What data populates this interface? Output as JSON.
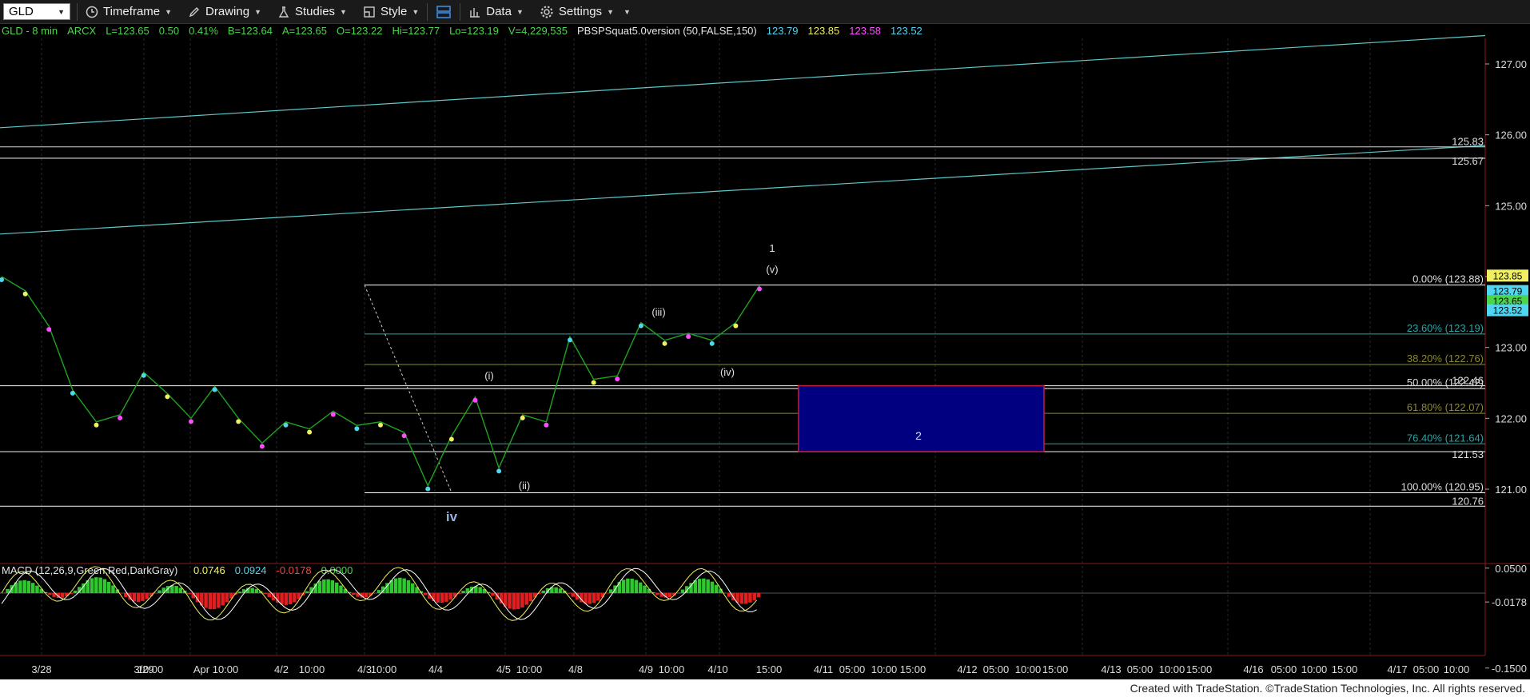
{
  "toolbar": {
    "symbol": "GLD",
    "items": [
      {
        "label": "Timeframe",
        "icon": "clock-icon"
      },
      {
        "label": "Drawing",
        "icon": "pencil-icon"
      },
      {
        "label": "Studies",
        "icon": "flask-icon"
      },
      {
        "label": "Style",
        "icon": "style-icon"
      },
      {
        "label": "",
        "icon": "layout-icon"
      },
      {
        "label": "Data",
        "icon": "bars-icon"
      },
      {
        "label": "Settings",
        "icon": "gear-icon"
      }
    ]
  },
  "header": {
    "items": [
      {
        "text": "GLD - 8 min",
        "color": "#4cd54c"
      },
      {
        "text": "ARCX",
        "color": "#4cd54c"
      },
      {
        "text": "L=123.65",
        "color": "#4cd54c"
      },
      {
        "text": "0.50",
        "color": "#4cd54c"
      },
      {
        "text": "0.41%",
        "color": "#4cd54c"
      },
      {
        "text": "B=123.64",
        "color": "#4cd54c"
      },
      {
        "text": "A=123.65",
        "color": "#4cd54c"
      },
      {
        "text": "O=123.22",
        "color": "#4cd54c"
      },
      {
        "text": "Hi=123.77",
        "color": "#4cd54c"
      },
      {
        "text": "Lo=123.19",
        "color": "#4cd54c"
      },
      {
        "text": "V=4,229,535",
        "color": "#4cd54c"
      },
      {
        "text": "PBSPSquat5.0version (50,FALSE,150)",
        "color": "#e6e6e6"
      },
      {
        "text": "123.79",
        "color": "#4fd6f0"
      },
      {
        "text": "123.85",
        "color": "#f0f060"
      },
      {
        "text": "123.58",
        "color": "#ff4cff"
      },
      {
        "text": "123.52",
        "color": "#4fd6f0"
      }
    ]
  },
  "chart_data": [
    {
      "type": "candlestick",
      "title": "GLD - 8 min",
      "ylim": [
        120.2,
        127.35
      ],
      "y_ticks": [
        "127.00",
        "126.00",
        "125.00",
        "124.00",
        "123.00",
        "122.00",
        "121.00"
      ],
      "x_tick_labels": [
        "3/28",
        "3/29",
        "10:00",
        "Apr",
        "10:00",
        "4/2",
        "10:00",
        "4/3",
        "10:00",
        "4/4",
        "4/5",
        "10:00",
        "4/8",
        "4/9",
        "10:00",
        "4/10",
        "15:00",
        "4/11",
        "05:00",
        "10:00",
        "15:00",
        "4/12",
        "05:00",
        "10:00",
        "15:00",
        "4/13",
        "05:00",
        "10:00",
        "15:00",
        "4/16",
        "05:00",
        "10:00",
        "15:00",
        "4/17",
        "05:00",
        "10:00"
      ],
      "price_series": [
        {
          "date": "3/28",
          "value": 124.0
        },
        {
          "date": "3/28",
          "value": 123.8
        },
        {
          "date": "3/28",
          "value": 123.3
        },
        {
          "date": "3/28",
          "value": 122.4
        },
        {
          "date": "3/28",
          "value": 121.95
        },
        {
          "date": "3/29",
          "value": 122.05
        },
        {
          "date": "3/29",
          "value": 122.65
        },
        {
          "date": "3/29",
          "value": 122.35
        },
        {
          "date": "3/29",
          "value": 122.0
        },
        {
          "date": "Apr",
          "value": 122.45
        },
        {
          "date": "Apr",
          "value": 122.0
        },
        {
          "date": "Apr",
          "value": 121.65
        },
        {
          "date": "4/2",
          "value": 121.95
        },
        {
          "date": "4/2",
          "value": 121.85
        },
        {
          "date": "4/2",
          "value": 122.1
        },
        {
          "date": "4/3",
          "value": 121.9
        },
        {
          "date": "4/3",
          "value": 121.95
        },
        {
          "date": "4/3",
          "value": 121.8
        },
        {
          "date": "4/4",
          "value": 121.05
        },
        {
          "date": "4/4",
          "value": 121.75
        },
        {
          "date": "4/4",
          "value": 122.3
        },
        {
          "date": "4/5",
          "value": 121.3
        },
        {
          "date": "4/5",
          "value": 122.05
        },
        {
          "date": "4/5",
          "value": 121.95
        },
        {
          "date": "4/8",
          "value": 123.15
        },
        {
          "date": "4/8",
          "value": 122.55
        },
        {
          "date": "4/8",
          "value": 122.6
        },
        {
          "date": "4/9",
          "value": 123.35
        },
        {
          "date": "4/9",
          "value": 123.1
        },
        {
          "date": "4/9",
          "value": 123.2
        },
        {
          "date": "4/10",
          "value": 123.1
        },
        {
          "date": "4/10",
          "value": 123.35
        },
        {
          "date": "4/10",
          "value": 123.87
        }
      ],
      "trend_lines": [
        {
          "from": {
            "date": "3/28",
            "value": 126.1
          },
          "to": {
            "date": "4/17",
            "value": 127.4
          }
        },
        {
          "from": {
            "date": "3/28",
            "value": 124.6
          },
          "to": {
            "date": "4/17",
            "value": 125.85
          }
        }
      ],
      "horizontal_lines": [
        125.83,
        125.67,
        122.46,
        121.53,
        120.76
      ],
      "price_labels": [
        "125.83",
        "125.67",
        "122.46",
        "121.53",
        "120.76"
      ],
      "fibonacci": {
        "levels": [
          {
            "label": "0.00% (123.88)",
            "value": 123.88
          },
          {
            "label": "23.60% (123.19)",
            "value": 123.19
          },
          {
            "label": "38.20% (122.76)",
            "value": 122.76
          },
          {
            "label": "50.00% (122.42)",
            "value": 122.42
          },
          {
            "label": "61.80% (122.07)",
            "value": 122.07
          },
          {
            "label": "76.40% (121.64)",
            "value": 121.64
          },
          {
            "label": "100.00% (120.95)",
            "value": 120.95
          }
        ],
        "colors": [
          "#ffffff",
          "#2aa6a6",
          "#8a8a2a",
          "#ffffff",
          "#8a8a2a",
          "#2aa6a6",
          "#ffffff"
        ]
      },
      "target_box": {
        "label": "2",
        "top": 122.46,
        "bottom": 121.53,
        "from": "4/10",
        "to": "4/12",
        "fill": "#000080",
        "border": "#c0203c"
      },
      "wave_labels": [
        {
          "text": "1",
          "value": 124.35
        },
        {
          "text": "(v)",
          "value": 124.05
        },
        {
          "text": "(iii)",
          "value": 123.45
        },
        {
          "text": "(iv)",
          "value": 122.6
        },
        {
          "text": "(i)",
          "value": 122.55
        },
        {
          "text": "(ii)",
          "value": 121.0
        },
        {
          "text": "iv",
          "value": 120.55
        }
      ],
      "last_price_tags": [
        {
          "text": "123.79",
          "color": "#4fd6f0"
        },
        {
          "text": "123.85",
          "color": "#f0f060"
        },
        {
          "text": "123.65",
          "color": "#4cd54c"
        },
        {
          "text": "123.52",
          "color": "#4fd6f0"
        }
      ]
    },
    {
      "type": "macd",
      "title": "MACD (12,26,9,Green,Red,DarkGray)",
      "legend": [
        {
          "text": "0.0746",
          "color": "#f0f060"
        },
        {
          "text": "0.0924",
          "color": "#4fd6f0"
        },
        {
          "text": "-0.0178",
          "color": "#ff4040"
        },
        {
          "text": "0.0000",
          "color": "#4cd54c"
        }
      ],
      "y_ticks": [
        "0.0500",
        "-0.0178",
        "-0.1500"
      ],
      "ylim": [
        -0.22,
        0.1
      ]
    }
  ],
  "footer": {
    "text": "Created with TradeStation. ©TradeStation Technologies, Inc. All rights reserved."
  }
}
